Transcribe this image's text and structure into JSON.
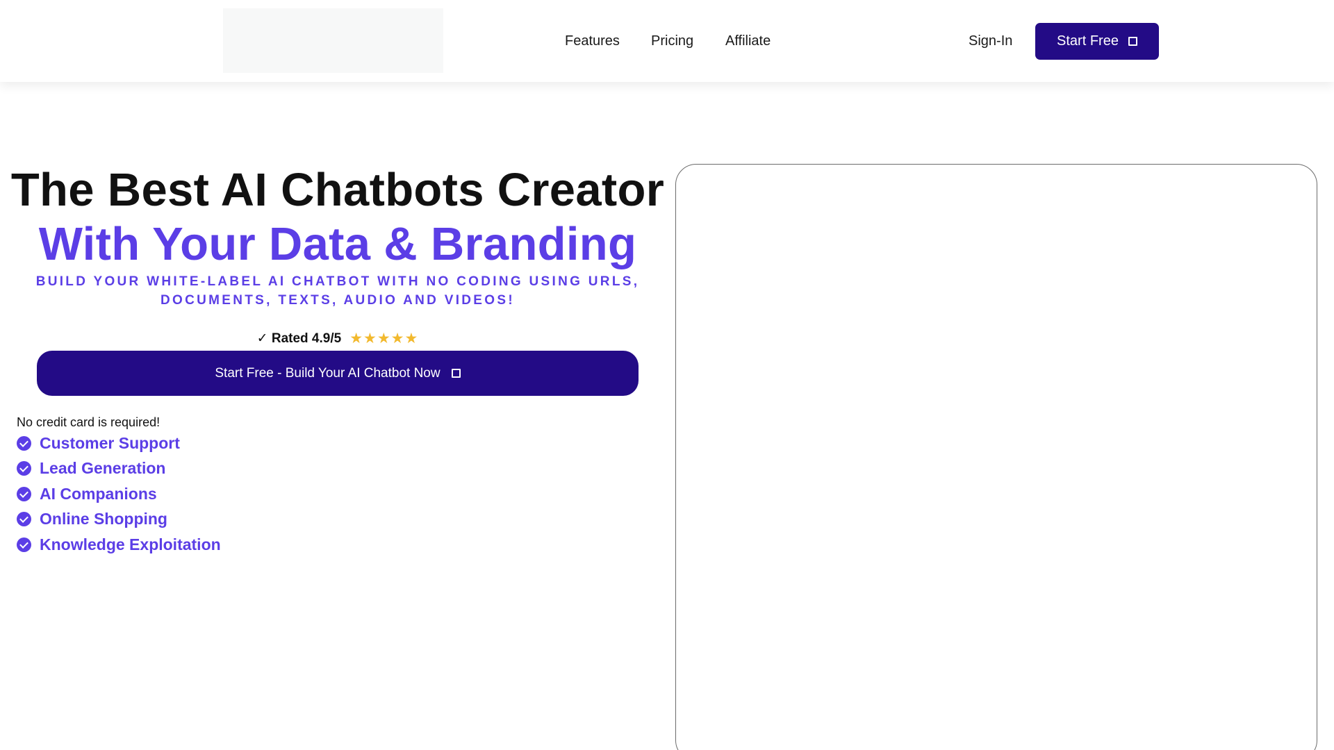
{
  "header": {
    "nav": [
      "Features",
      "Pricing",
      "Affiliate"
    ],
    "sign_in": "Sign-In",
    "start_free": "Start Free",
    "start_free_icon": "external-square-icon"
  },
  "hero": {
    "title": "The Best AI Chatbots Creator",
    "title_accent": "With Your Data & Branding",
    "subtitle": "BUILD YOUR WHITE-LABEL AI CHATBOT WITH NO CODING USING URLS, DOCUMENTS, TEXTS, AUDIO AND VIDEOS!",
    "rating_text": "✓ Rated 4.9/5",
    "stars": "★★★★★",
    "cta": "Start Free - Build Your AI Chatbot Now",
    "no_credit_card": "No credit card is required!",
    "features": [
      "Customer Support",
      "Lead Generation",
      "AI Companions",
      "Online Shopping",
      "Knowledge Exploitation"
    ]
  },
  "colors": {
    "primary": "#230b86",
    "accent": "#5b3ee6",
    "star": "#f2b92e"
  }
}
